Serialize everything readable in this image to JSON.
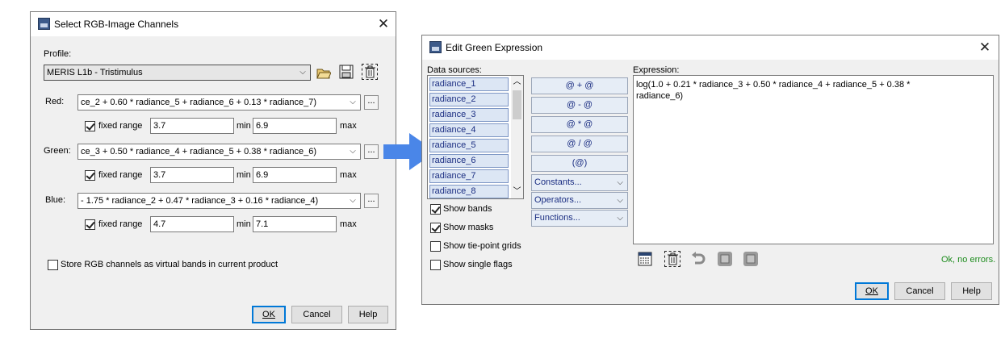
{
  "rgb_dialog": {
    "title": "Select RGB-Image Channels",
    "profile_label": "Profile:",
    "profile_value": "MERIS L1b - Tristimulus",
    "channels": [
      {
        "label": "Red:",
        "expression": "ce_2 + 0.60 * radiance_5 + radiance_6 + 0.13 * radiance_7)",
        "fixed_label": "fixed range",
        "fixed_checked": true,
        "min_value": "3.7",
        "max_value": "6.9",
        "min_label": "min",
        "max_label": "max"
      },
      {
        "label": "Green:",
        "expression": "ce_3 + 0.50 * radiance_4 + radiance_5 + 0.38 * radiance_6)",
        "fixed_label": "fixed range",
        "fixed_checked": true,
        "min_value": "3.7",
        "max_value": "6.9",
        "min_label": "min",
        "max_label": "max"
      },
      {
        "label": "Blue:",
        "expression": "- 1.75 * radiance_2 + 0.47 * radiance_3 + 0.16 * radiance_4)",
        "fixed_label": "fixed range",
        "fixed_checked": true,
        "min_value": "4.7",
        "max_value": "7.1",
        "min_label": "min",
        "max_label": "max"
      }
    ],
    "edit_btn": "...",
    "store_virtual_label": "Store RGB channels as virtual bands in current product",
    "store_virtual_checked": false,
    "ok": "OK",
    "cancel": "Cancel",
    "help": "Help"
  },
  "expr_dialog": {
    "title": "Edit Green Expression",
    "data_sources_label": "Data sources:",
    "data_sources": [
      "radiance_1",
      "radiance_2",
      "radiance_3",
      "radiance_4",
      "radiance_5",
      "radiance_6",
      "radiance_7",
      "radiance_8"
    ],
    "operator_buttons": [
      "@ + @",
      "@ - @",
      "@ * @",
      "@ / @",
      "(@)"
    ],
    "dropdowns": [
      "Constants...",
      "Operators...",
      "Functions..."
    ],
    "checkboxes": [
      {
        "label": "Show bands",
        "checked": true
      },
      {
        "label": "Show masks",
        "checked": true
      },
      {
        "label": "Show tie-point grids",
        "checked": false
      },
      {
        "label": "Show single flags",
        "checked": false
      }
    ],
    "expression_label": "Expression:",
    "expression_line1": "log(1.0 + 0.21 * radiance_3 + 0.50 * radiance_4 + radiance_5 + 0.38 *",
    "expression_line2": "radiance_6)",
    "status": "Ok, no errors.",
    "ok": "OK",
    "cancel": "Cancel",
    "help": "Help"
  },
  "colors": {
    "accent": "#0078d7",
    "arrow": "#4a86e8",
    "status_ok": "#1e8c1e",
    "list_text": "#1b2e82"
  }
}
